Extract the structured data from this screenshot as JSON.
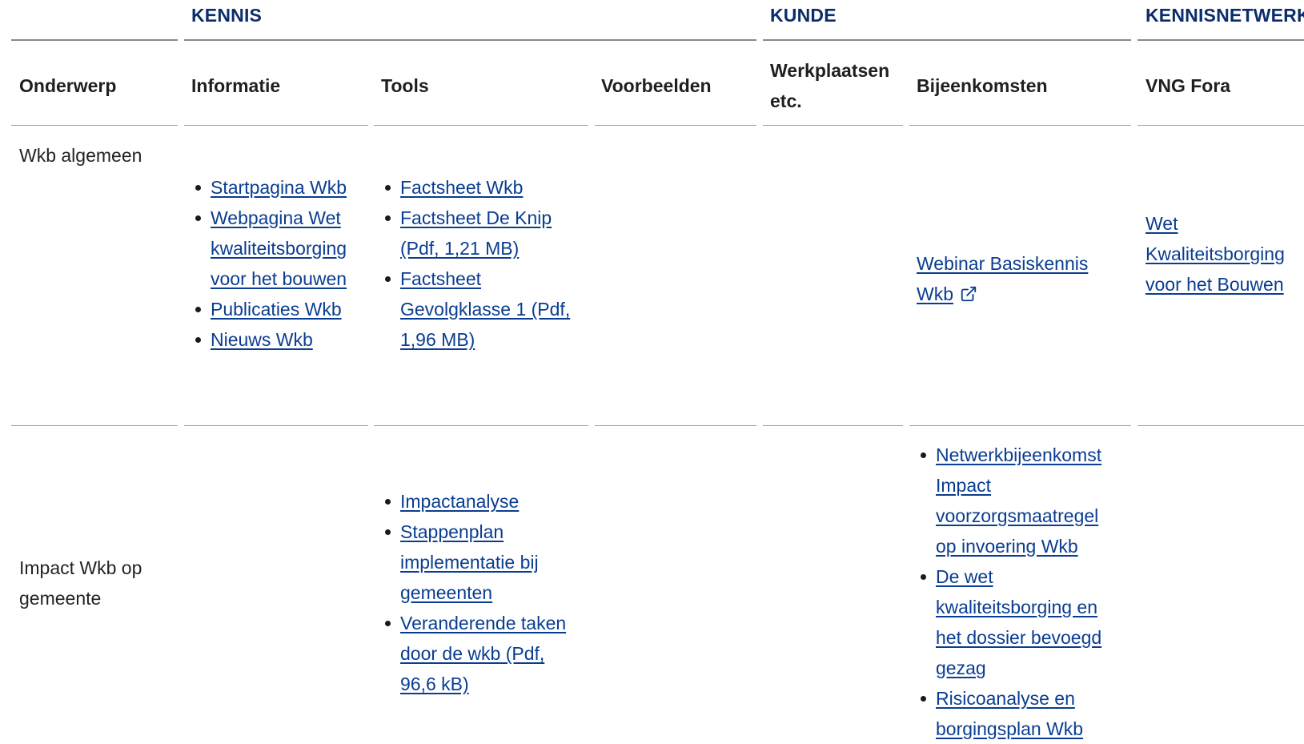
{
  "groups": {
    "kennis": "KENNIS",
    "kunde": "KUNDE",
    "kennisnetwerk": "KENNISNETWERK"
  },
  "columns": {
    "onderwerp": "Onderwerp",
    "informatie": "Informatie",
    "tools": "Tools",
    "voorbeelden": "Voorbeelden",
    "werkplaatsen": "Werkplaatsen etc.",
    "bijeenkomsten": "Bijeenkomsten",
    "vng_fora": "VNG Fora"
  },
  "rows": [
    {
      "topic": "Wkb algemeen",
      "informatie": [
        "Startpagina Wkb",
        "Webpagina Wet kwaliteitsborging voor het bouwen",
        "Publicaties Wkb",
        "Nieuws Wkb"
      ],
      "tools": [
        "Factsheet Wkb",
        "Factsheet De Knip (Pdf, 1,21 MB)",
        "Factsheet Gevolgklasse 1 (Pdf, 1,96 MB)"
      ],
      "bijeenkomsten_link": "Webinar Basiskennis Wkb",
      "vng_fora_link": "Wet Kwaliteitsborging voor het Bouwen"
    },
    {
      "topic": "Impact Wkb op gemeente",
      "tools": [
        "Impactanalyse",
        "Stappenplan implementatie bij gemeenten",
        "Veranderende taken door de wkb (Pdf, 96,6 kB)"
      ],
      "bijeenkomsten": [
        "Netwerkbijeenkomst Impact voorzorgsmaatregel op invoering Wkb",
        "De wet kwaliteitsborging en het dossier bevoegd gezag",
        "Risicoanalyse en borgingsplan Wkb"
      ]
    }
  ],
  "colors": {
    "link": "#0a3d91",
    "group_heading": "#0b2d6b",
    "rule": "#8a8a8a"
  },
  "icons": {
    "external_link": "external-link-icon",
    "bullet": "bullet-icon"
  }
}
